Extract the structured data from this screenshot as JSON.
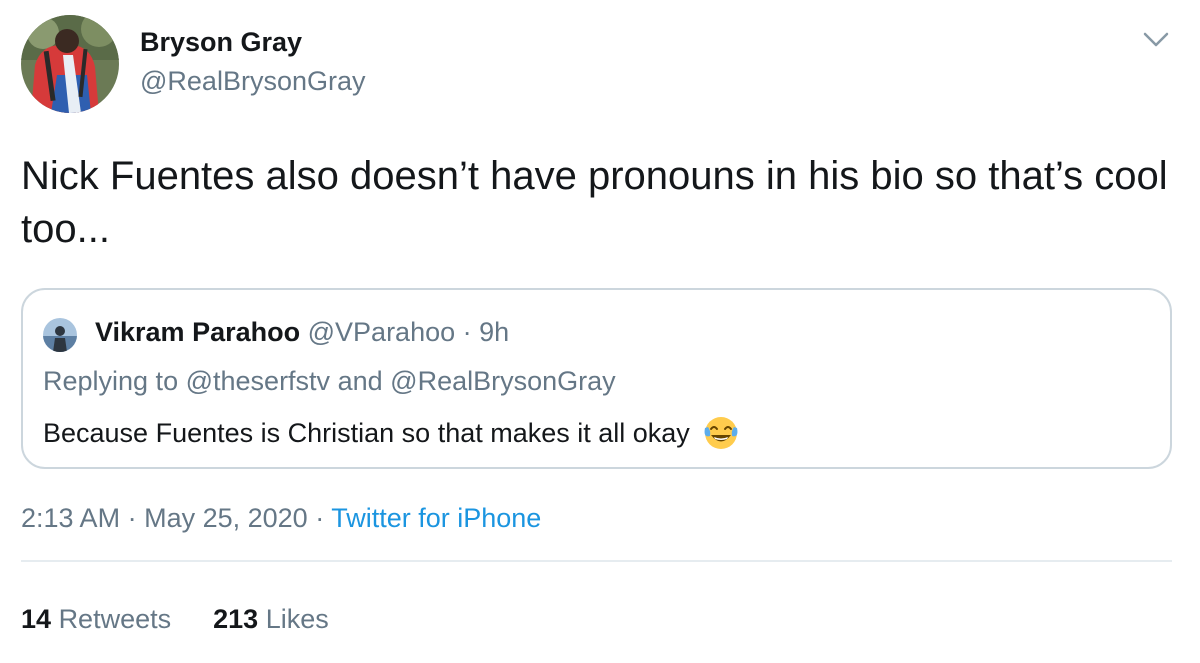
{
  "author": {
    "display_name": "Bryson Gray",
    "handle": "@RealBrysonGray"
  },
  "tweet": {
    "text": "Nick Fuentes also doesn’t have pronouns in his bio so that’s cool too..."
  },
  "quoted_tweet": {
    "display_name": "Vikram Parahoo",
    "handle": "@VParahoo",
    "separator": "·",
    "age": "9h",
    "replying_label": "Replying to",
    "reply_target_1": "@theserfstv",
    "reply_and": "and",
    "reply_target_2": "@RealBrysonGray",
    "text": "Because Fuentes is Christian so that makes it all okay",
    "emoji_icon": "face-with-tears-of-joy-icon"
  },
  "meta": {
    "time": "2:13 AM",
    "separator": "·",
    "date": "May 25, 2020",
    "source": "Twitter for iPhone"
  },
  "stats": {
    "retweets_count": "14",
    "retweets_label": "Retweets",
    "likes_count": "213",
    "likes_label": "Likes"
  },
  "colors": {
    "text_primary": "#14171a",
    "text_secondary": "#657786",
    "link": "#1b95e0",
    "border": "#ccd6dd",
    "divider": "#e6ecf0"
  }
}
